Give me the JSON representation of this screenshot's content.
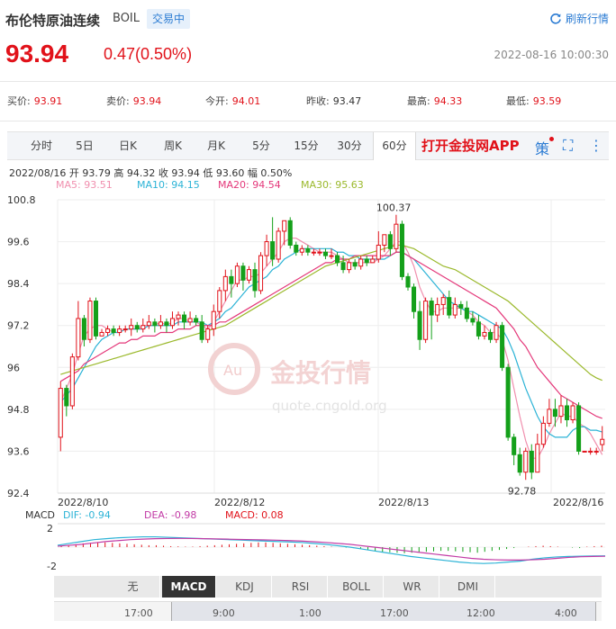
{
  "header": {
    "title": "布伦特原油连续",
    "code": "BOIL",
    "status": "交易中",
    "refresh_label": "刷新行情"
  },
  "price": {
    "last": "93.94",
    "change": "0.47(0.50%)",
    "timestamp": "2022-08-16 10:00:30"
  },
  "quote": [
    {
      "label": "买价:",
      "value": "93.91",
      "color": "red"
    },
    {
      "label": "卖价:",
      "value": "93.94",
      "color": "red"
    },
    {
      "label": "今开:",
      "value": "94.01",
      "color": "red"
    },
    {
      "label": "昨收:",
      "value": "93.47",
      "color": "plain"
    },
    {
      "label": "最高:",
      "value": "94.33",
      "color": "red"
    },
    {
      "label": "最低:",
      "value": "93.59",
      "color": "red"
    }
  ],
  "tabs": [
    "分时",
    "5日",
    "日K",
    "周K",
    "月K",
    "5分",
    "15分",
    "30分",
    "60分"
  ],
  "active_tab": "60分",
  "app_link": "打开金投网APP",
  "tool_icons": {
    "strategy": "策",
    "fullscreen": "⛶",
    "more": "⋮"
  },
  "ohlc_line": "2022/08/16  开 93.79  高 94.32  收 93.94  低 93.60  幅 0.50%",
  "ma": [
    {
      "label": "MA5: 93.51",
      "color": "#f08fae"
    },
    {
      "label": "MA10: 94.15",
      "color": "#2cb3d6"
    },
    {
      "label": "MA20: 94.54",
      "color": "#e4387a"
    },
    {
      "label": "MA30: 95.63",
      "color": "#9bb92c"
    }
  ],
  "watermark": {
    "brand": "金投行情",
    "url": "quote.cngold.org"
  },
  "chart_data": {
    "type": "candlestick",
    "y_ticks": [
      "100.8",
      "99.6",
      "98.4",
      "97.2",
      "96",
      "94.8",
      "93.6",
      "92.4"
    ],
    "ylim": [
      92.4,
      100.8
    ],
    "x_labels": [
      "2022/8/10",
      "2022/8/12",
      "2022/8/13",
      "2022/8/16"
    ],
    "annotations": {
      "high": "100.37",
      "low": "92.78"
    },
    "candles": [
      [
        94.0,
        95.4,
        93.6,
        95.6
      ],
      [
        95.4,
        94.9,
        94.6,
        95.5
      ],
      [
        94.9,
        96.3,
        94.8,
        96.4
      ],
      [
        96.3,
        97.4,
        96.2,
        97.9
      ],
      [
        97.4,
        96.8,
        96.6,
        97.5
      ],
      [
        96.8,
        97.9,
        96.7,
        98.0
      ],
      [
        97.9,
        96.9,
        96.8,
        98.0
      ],
      [
        96.9,
        97.0,
        96.9,
        97.1
      ],
      [
        97.0,
        97.1,
        96.9,
        97.2
      ],
      [
        97.1,
        97.0,
        96.9,
        97.2
      ],
      [
        97.0,
        97.1,
        96.9,
        97.2
      ],
      [
        97.1,
        97.1,
        97.0,
        97.2
      ],
      [
        97.1,
        97.2,
        96.9,
        97.4
      ],
      [
        97.2,
        97.1,
        97.0,
        97.3
      ],
      [
        97.1,
        97.2,
        97.0,
        97.4
      ],
      [
        97.2,
        97.3,
        97.1,
        97.5
      ],
      [
        97.3,
        97.2,
        97.0,
        97.4
      ],
      [
        97.2,
        97.3,
        97.1,
        97.5
      ],
      [
        97.3,
        97.2,
        97.0,
        97.4
      ],
      [
        97.2,
        97.4,
        97.1,
        97.6
      ],
      [
        97.4,
        97.5,
        97.2,
        97.6
      ],
      [
        97.5,
        97.3,
        97.1,
        97.6
      ],
      [
        97.3,
        97.4,
        97.2,
        97.6
      ],
      [
        97.4,
        97.3,
        97.2,
        97.5
      ],
      [
        97.3,
        96.8,
        96.7,
        97.5
      ],
      [
        96.8,
        97.1,
        96.7,
        97.2
      ],
      [
        97.1,
        97.6,
        96.9,
        97.8
      ],
      [
        97.6,
        98.2,
        97.4,
        98.3
      ],
      [
        98.2,
        98.6,
        97.9,
        98.8
      ],
      [
        98.6,
        98.4,
        98.0,
        98.8
      ],
      [
        98.4,
        98.9,
        98.3,
        99.0
      ],
      [
        98.9,
        98.5,
        98.2,
        99.0
      ],
      [
        98.5,
        98.8,
        98.4,
        98.9
      ],
      [
        98.8,
        98.2,
        98.0,
        99.0
      ],
      [
        98.2,
        99.2,
        98.1,
        99.3
      ],
      [
        99.2,
        99.6,
        98.9,
        99.8
      ],
      [
        99.6,
        99.1,
        98.9,
        100.3
      ],
      [
        99.1,
        99.9,
        99.0,
        100.0
      ],
      [
        99.9,
        100.2,
        99.5,
        100.2
      ],
      [
        100.2,
        99.5,
        99.4,
        100.3
      ],
      [
        99.5,
        99.3,
        99.2,
        99.6
      ],
      [
        99.3,
        99.4,
        99.2,
        99.5
      ],
      [
        99.4,
        99.3,
        99.2,
        99.5
      ],
      [
        99.3,
        99.3,
        99.2,
        99.4
      ],
      [
        99.3,
        99.3,
        99.2,
        99.4
      ],
      [
        99.3,
        99.2,
        99.1,
        99.4
      ],
      [
        99.2,
        99.2,
        99.1,
        99.4
      ],
      [
        99.2,
        99.0,
        98.9,
        99.3
      ],
      [
        99.0,
        98.8,
        98.7,
        99.2
      ],
      [
        98.8,
        99.0,
        98.7,
        99.1
      ],
      [
        99.0,
        98.9,
        98.8,
        99.1
      ],
      [
        98.9,
        99.1,
        98.8,
        99.2
      ],
      [
        99.1,
        99.0,
        98.9,
        99.2
      ],
      [
        99.0,
        99.1,
        99.0,
        99.2
      ],
      [
        99.1,
        99.5,
        99.0,
        99.9
      ],
      [
        99.5,
        99.8,
        99.3,
        99.8
      ],
      [
        99.8,
        99.4,
        99.2,
        99.9
      ],
      [
        99.4,
        100.1,
        99.3,
        100.37
      ],
      [
        100.1,
        98.6,
        98.5,
        100.2
      ],
      [
        98.6,
        98.3,
        98.2,
        98.7
      ],
      [
        98.3,
        97.6,
        97.4,
        98.4
      ],
      [
        97.6,
        96.8,
        96.5,
        97.9
      ],
      [
        96.8,
        97.9,
        96.7,
        98.0
      ],
      [
        97.9,
        97.5,
        96.8,
        98.0
      ],
      [
        97.5,
        97.8,
        97.3,
        98.0
      ],
      [
        97.8,
        98.0,
        97.5,
        98.1
      ],
      [
        98.0,
        97.5,
        97.4,
        98.2
      ],
      [
        97.5,
        97.8,
        97.4,
        98.0
      ],
      [
        97.8,
        97.7,
        97.5,
        97.9
      ],
      [
        97.7,
        97.4,
        97.3,
        97.9
      ],
      [
        97.4,
        97.3,
        97.2,
        97.6
      ],
      [
        97.3,
        96.9,
        96.8,
        97.5
      ],
      [
        96.9,
        97.0,
        96.8,
        97.2
      ],
      [
        97.0,
        96.8,
        96.7,
        97.1
      ],
      [
        96.8,
        97.2,
        96.7,
        97.3
      ],
      [
        97.2,
        96.0,
        95.9,
        97.3
      ],
      [
        96.0,
        94.0,
        93.9,
        96.1
      ],
      [
        94.0,
        93.5,
        93.2,
        94.1
      ],
      [
        93.5,
        93.0,
        92.9,
        93.7
      ],
      [
        93.0,
        93.6,
        92.78,
        93.7
      ],
      [
        93.6,
        93.0,
        92.8,
        93.8
      ],
      [
        93.0,
        93.8,
        93.0,
        94.1
      ],
      [
        93.8,
        94.4,
        93.7,
        94.6
      ],
      [
        94.4,
        94.8,
        94.3,
        95.1
      ],
      [
        94.8,
        94.6,
        94.3,
        95.1
      ],
      [
        94.6,
        94.9,
        94.4,
        95.2
      ],
      [
        94.9,
        94.5,
        94.3,
        95.1
      ],
      [
        94.5,
        94.9,
        94.4,
        95.0
      ],
      [
        94.9,
        93.6,
        93.5,
        95.0
      ],
      [
        93.6,
        93.6,
        93.6,
        93.6
      ],
      [
        93.6,
        93.6,
        93.5,
        93.7
      ],
      [
        93.6,
        93.6,
        93.5,
        93.7
      ],
      [
        93.79,
        93.94,
        93.6,
        94.32
      ]
    ],
    "ma5": [
      95.0,
      95.4,
      95.8,
      96.4,
      96.9,
      97.1,
      97.2,
      97.2,
      97.1,
      97.0,
      97.0,
      97.1,
      97.1,
      97.1,
      97.2,
      97.2,
      97.2,
      97.3,
      97.2,
      97.3,
      97.4,
      97.4,
      97.3,
      97.3,
      97.2,
      97.1,
      97.3,
      97.6,
      97.9,
      98.2,
      98.5,
      98.5,
      98.6,
      98.6,
      98.7,
      98.9,
      99.1,
      99.3,
      99.6,
      99.7,
      99.7,
      99.6,
      99.5,
      99.4,
      99.3,
      99.3,
      99.3,
      99.2,
      99.1,
      99.0,
      99.0,
      99.0,
      99.0,
      99.0,
      99.1,
      99.2,
      99.4,
      99.6,
      99.6,
      99.3,
      98.9,
      98.3,
      97.9,
      97.6,
      97.6,
      97.7,
      97.7,
      97.7,
      97.7,
      97.6,
      97.5,
      97.3,
      97.2,
      97.0,
      97.0,
      96.8,
      96.2,
      95.4,
      94.6,
      93.9,
      93.4,
      93.4,
      93.7,
      94.1,
      94.4,
      94.7,
      94.6,
      94.6,
      94.4,
      94.3,
      94.1,
      93.8,
      93.5
    ],
    "ma10": [
      95.0,
      95.2,
      95.4,
      95.7,
      96.0,
      96.3,
      96.6,
      96.8,
      96.9,
      97.0,
      97.0,
      97.1,
      97.1,
      97.1,
      97.1,
      97.2,
      97.2,
      97.2,
      97.2,
      97.2,
      97.3,
      97.3,
      97.3,
      97.3,
      97.3,
      97.2,
      97.3,
      97.4,
      97.6,
      97.7,
      97.9,
      98.1,
      98.3,
      98.4,
      98.5,
      98.6,
      98.8,
      98.9,
      99.1,
      99.2,
      99.3,
      99.4,
      99.4,
      99.4,
      99.4,
      99.4,
      99.4,
      99.3,
      99.3,
      99.2,
      99.2,
      99.1,
      99.1,
      99.1,
      99.1,
      99.1,
      99.2,
      99.3,
      99.3,
      99.2,
      99.1,
      98.9,
      98.7,
      98.5,
      98.3,
      98.1,
      97.9,
      97.8,
      97.7,
      97.6,
      97.6,
      97.5,
      97.4,
      97.3,
      97.2,
      97.1,
      96.8,
      96.4,
      95.9,
      95.4,
      95.0,
      94.6,
      94.3,
      94.1,
      94.0,
      94.0,
      94.0,
      94.2,
      94.3,
      94.3,
      94.2,
      94.2,
      94.15
    ],
    "ma20": [
      95.6,
      95.7,
      95.8,
      95.9,
      96.1,
      96.2,
      96.3,
      96.4,
      96.5,
      96.6,
      96.7,
      96.7,
      96.8,
      96.8,
      96.9,
      96.9,
      96.9,
      97.0,
      97.0,
      97.0,
      97.1,
      97.1,
      97.1,
      97.2,
      97.2,
      97.2,
      97.2,
      97.3,
      97.3,
      97.4,
      97.5,
      97.6,
      97.7,
      97.8,
      97.9,
      98.0,
      98.1,
      98.2,
      98.3,
      98.4,
      98.5,
      98.6,
      98.7,
      98.8,
      98.9,
      99.0,
      99.0,
      99.1,
      99.1,
      99.1,
      99.2,
      99.2,
      99.2,
      99.2,
      99.2,
      99.2,
      99.2,
      99.3,
      99.3,
      99.2,
      99.1,
      99.0,
      98.9,
      98.8,
      98.7,
      98.6,
      98.5,
      98.4,
      98.3,
      98.2,
      98.1,
      98.0,
      97.9,
      97.8,
      97.7,
      97.5,
      97.3,
      97.1,
      96.8,
      96.6,
      96.3,
      96.0,
      95.8,
      95.6,
      95.4,
      95.2,
      95.1,
      95.0,
      94.9,
      94.8,
      94.7,
      94.6,
      94.54
    ],
    "ma30": [
      95.8,
      95.85,
      95.9,
      95.95,
      96.0,
      96.05,
      96.1,
      96.15,
      96.2,
      96.25,
      96.3,
      96.35,
      96.4,
      96.45,
      96.5,
      96.55,
      96.6,
      96.65,
      96.7,
      96.75,
      96.8,
      96.85,
      96.9,
      96.95,
      97.0,
      97.05,
      97.1,
      97.15,
      97.2,
      97.3,
      97.4,
      97.5,
      97.6,
      97.7,
      97.8,
      97.9,
      98.0,
      98.1,
      98.2,
      98.3,
      98.4,
      98.5,
      98.6,
      98.7,
      98.8,
      98.9,
      98.95,
      99.0,
      99.05,
      99.1,
      99.15,
      99.2,
      99.25,
      99.3,
      99.35,
      99.4,
      99.45,
      99.5,
      99.5,
      99.45,
      99.4,
      99.3,
      99.2,
      99.1,
      99.0,
      98.9,
      98.85,
      98.8,
      98.7,
      98.6,
      98.5,
      98.4,
      98.3,
      98.2,
      98.1,
      98.0,
      97.9,
      97.75,
      97.6,
      97.45,
      97.3,
      97.15,
      97.0,
      96.85,
      96.7,
      96.55,
      96.4,
      96.25,
      96.1,
      95.95,
      95.8,
      95.7,
      95.63
    ]
  },
  "macd": {
    "title": "MACD",
    "dif": "DIF: -0.94",
    "dea": "DEA: -0.98",
    "macd": "MACD: 0.08",
    "y_ticks": [
      "2",
      "-2"
    ],
    "ylim": [
      -2.5,
      2.5
    ],
    "hist": [
      0.1,
      0.2,
      0.3,
      0.4,
      0.45,
      0.5,
      0.5,
      0.45,
      0.4,
      0.35,
      0.3,
      0.25,
      0.2,
      0.2,
      0.15,
      0.1,
      0.08,
      0.05,
      0.05,
      0.1,
      0.15,
      0.2,
      0.25,
      0.3,
      0.35,
      0.4,
      0.45,
      0.5,
      0.5,
      0.45,
      0.4,
      0.35,
      0.3,
      0.25,
      0.2,
      0.15,
      0.1,
      0.05,
      0.0,
      -0.05,
      -0.1,
      -0.2,
      -0.3,
      -0.4,
      -0.5,
      -0.55,
      -0.6,
      -0.65,
      -0.6,
      -0.55,
      -0.5,
      -0.45,
      -0.4,
      -0.4,
      -0.45,
      -0.5,
      -0.55,
      -0.6,
      -0.5,
      -0.4,
      -0.3,
      -0.2,
      -0.1,
      0.0,
      0.05,
      0.1,
      0.15,
      0.1,
      0.05,
      0.0,
      -0.05,
      -0.1,
      0.05,
      0.1,
      0.15
    ],
    "dif_line": [
      0.2,
      0.4,
      0.6,
      0.8,
      0.9,
      1.0,
      1.05,
      1.1,
      1.1,
      1.05,
      1.0,
      0.95,
      0.9,
      0.85,
      0.8,
      0.75,
      0.7,
      0.65,
      0.6,
      0.55,
      0.5,
      0.4,
      0.3,
      0.15,
      0.0,
      -0.2,
      -0.4,
      -0.6,
      -0.8,
      -1.0,
      -1.15,
      -1.3,
      -1.45,
      -1.6,
      -1.7,
      -1.75,
      -1.7,
      -1.6,
      -1.5,
      -1.3,
      -1.15,
      -1.05,
      -1.0,
      -0.97,
      -0.95,
      -0.94
    ],
    "dea_line": [
      0.1,
      0.2,
      0.3,
      0.45,
      0.6,
      0.7,
      0.8,
      0.85,
      0.9,
      0.92,
      0.93,
      0.92,
      0.9,
      0.88,
      0.85,
      0.82,
      0.8,
      0.77,
      0.74,
      0.7,
      0.65,
      0.58,
      0.5,
      0.4,
      0.3,
      0.15,
      0.0,
      -0.15,
      -0.3,
      -0.45,
      -0.6,
      -0.75,
      -0.9,
      -1.05,
      -1.2,
      -1.3,
      -1.35,
      -1.38,
      -1.38,
      -1.35,
      -1.3,
      -1.2,
      -1.1,
      -1.03,
      -1.0,
      -0.98
    ]
  },
  "indicator_tabs": [
    "无",
    "MACD",
    "KDJ",
    "RSI",
    "BOLL",
    "WR",
    "DMI"
  ],
  "active_indicator": "MACD",
  "scroll_labels": [
    "17:00",
    "9:00",
    "1:00",
    "17:00",
    "12:00",
    "4:00"
  ]
}
